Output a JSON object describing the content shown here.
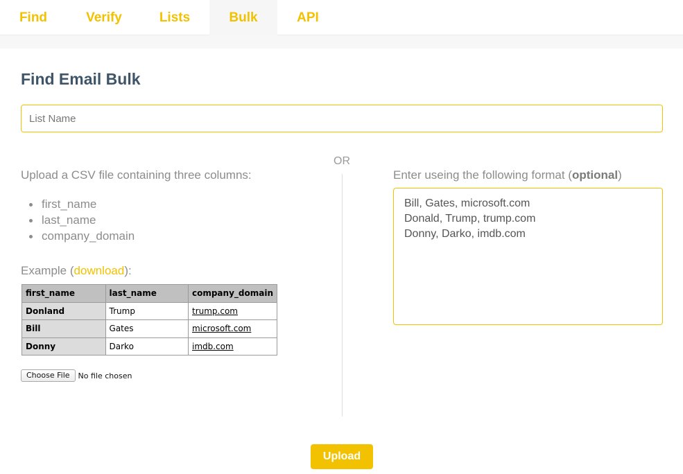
{
  "nav": {
    "tabs": [
      {
        "label": "Find",
        "active": false
      },
      {
        "label": "Verify",
        "active": false
      },
      {
        "label": "Lists",
        "active": false
      },
      {
        "label": "Bulk",
        "active": true
      },
      {
        "label": "API",
        "active": false
      }
    ]
  },
  "page": {
    "title": "Find Email Bulk"
  },
  "list_name": {
    "placeholder": "List Name",
    "value": ""
  },
  "divider": {
    "or_label": "OR"
  },
  "csv": {
    "description": "Upload a CSV file containing three columns:",
    "columns": [
      "first_name",
      "last_name",
      "company_domain"
    ],
    "example_prefix": "Example (",
    "download_label": "download",
    "example_suffix": "):",
    "example_table": {
      "headers": [
        "first_name",
        "last_name",
        "company_domain"
      ],
      "rows": [
        [
          "Donland",
          "Trump",
          "trump.com"
        ],
        [
          "Bill",
          "Gates",
          "microsoft.com"
        ],
        [
          "Donny",
          "Darko",
          "imdb.com"
        ]
      ]
    },
    "file_button_label": "Choose File",
    "file_status": "No file chosen"
  },
  "manual": {
    "label_prefix": "Enter useing the following format (",
    "label_bold": "optional",
    "label_suffix": ")",
    "lines": [
      "Bill, Gates, microsoft.com",
      "Donald, Trump, trump.com",
      "Donny, Darko, imdb.com"
    ]
  },
  "actions": {
    "upload_label": "Upload"
  },
  "colors": {
    "accent": "#f2c200",
    "title": "#3e5569",
    "muted_text": "#8c8c8c"
  }
}
